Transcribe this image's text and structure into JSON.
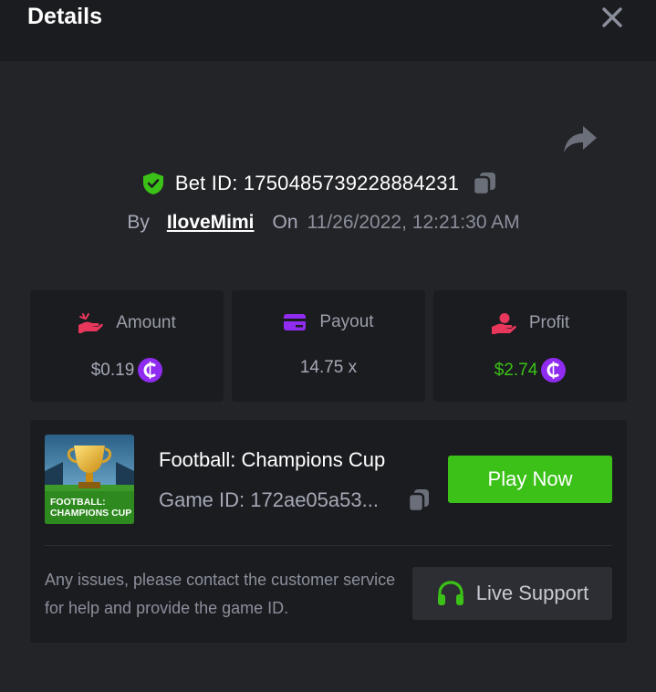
{
  "header": {
    "title": "Details"
  },
  "bet": {
    "id_label": "Bet ID: 1750485739228884231",
    "by_label": "By",
    "username": "IloveMimi",
    "on_label": "On",
    "date": "11/26/2022, 12:21:30 AM"
  },
  "stats": {
    "amount": {
      "label": "Amount",
      "value": "$0.19",
      "icon": "hand-money-icon"
    },
    "payout": {
      "label": "Payout",
      "value": "14.75 x",
      "icon": "card-icon"
    },
    "profit": {
      "label": "Profit",
      "value": "$2.74",
      "icon": "hand-coin-icon"
    }
  },
  "game": {
    "name": "Football: Champions Cup",
    "id_text": "Game ID: 172ae05a53...",
    "thumb_line1": "FOOTBALL:",
    "thumb_line2": "CHAMPIONS CUP",
    "play_label": "Play Now",
    "help_text": "Any issues, please contact the customer service for help and provide the game ID.",
    "support_label": "Live Support"
  },
  "colors": {
    "accent_green": "#3bc117",
    "coin_purple": "#8f2cf0",
    "amount_icon": "#e8375b",
    "payout_icon": "#8f2cf0",
    "profit_icon": "#e8375b"
  }
}
